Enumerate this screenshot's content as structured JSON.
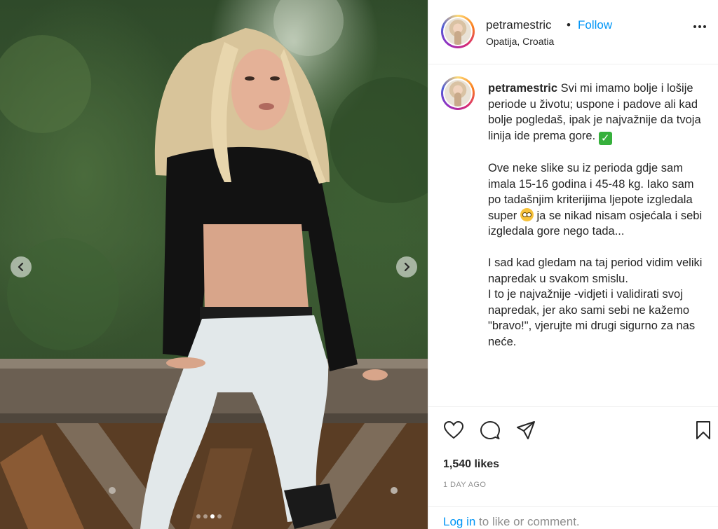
{
  "post": {
    "username": "petramestric",
    "separator": "•",
    "follow_label": "Follow",
    "location": "Opatija, Croatia"
  },
  "caption": {
    "username": "petramestric",
    "part1": "Svi mi imamo bolje i lošije periode u životu; uspone i padove ali kad bolje pogledaš, ipak je najvažnije da tvoja linija ide prema gore. ",
    "part2": "\n\nOve neke slike su iz perioda gdje sam imala 15-16 godina i 45-48 kg. Iako sam po tadašnjim kriterijima ljepote izgledala super ",
    "part3": " ja se nikad nisam osjećala i sebi izgledala gore nego tada...\n\nI sad kad gledam na taj period vidim veliki napredak u svakom smislu.\nI to je najvažnije -vidjeti i validirati svoj napredak, jer ako sami sebi ne kažemo \"bravo!\", vjerujte mi drugi sigurno za nas neće."
  },
  "stats": {
    "likes": "1,540 likes",
    "timestamp": "1 DAY AGO"
  },
  "login": {
    "link": "Log in",
    "rest": " to like or comment."
  },
  "carousel": {
    "slide_count": 4,
    "active_index": 2
  },
  "colors": {
    "accent": "#0095f6",
    "text": "#262626",
    "muted": "#8e8e8e",
    "border": "#efefef"
  },
  "icons": [
    "chevron-left-icon",
    "chevron-right-icon",
    "more-icon",
    "heart-icon",
    "comment-icon",
    "share-icon",
    "bookmark-icon",
    "check-mark-emoji",
    "flushed-face-emoji"
  ]
}
